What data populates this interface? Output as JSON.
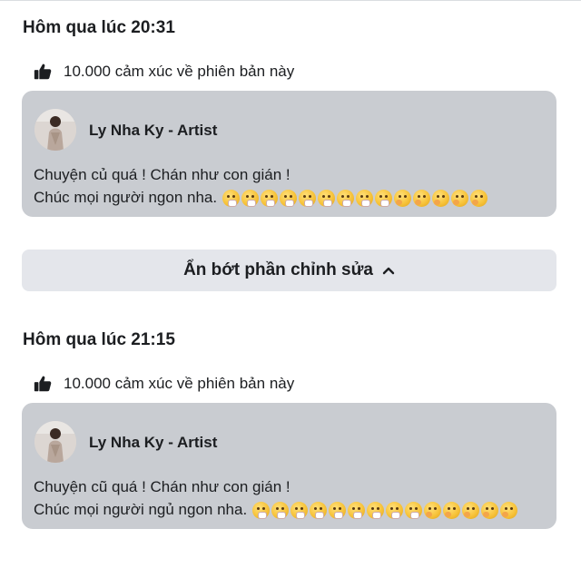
{
  "revisions": [
    {
      "timestamp": "Hôm qua lúc 20:31",
      "reactions_text": "10.000 cảm xúc về phiên bản này",
      "author": "Ly Nha Ky - Artist",
      "line1": "Chuyện củ quá ! Chán như con gián !",
      "line2": "Chúc mọi người ngon nha.",
      "emoji_count": 14
    },
    {
      "timestamp": "Hôm qua lúc 21:15",
      "reactions_text": "10.000 cảm xúc về phiên bản này",
      "author": "Ly Nha Ky - Artist",
      "line1": "Chuyện cũ quá ! Chán như con gián !",
      "line2": "Chúc mọi người ngủ ngon nha.",
      "emoji_count": 14
    }
  ],
  "collapse_label": "Ẩn bớt phần chỉnh sửa",
  "icons": {
    "reaction": "thumbs-up-icon",
    "collapse": "chevron-up-icon",
    "emoji_a": "face-with-hand-over-mouth",
    "emoji_b": "thinking-face"
  },
  "colors": {
    "card_bg": "#c9ccd1",
    "button_bg": "#e4e6eb",
    "text": "#1c1e21"
  }
}
